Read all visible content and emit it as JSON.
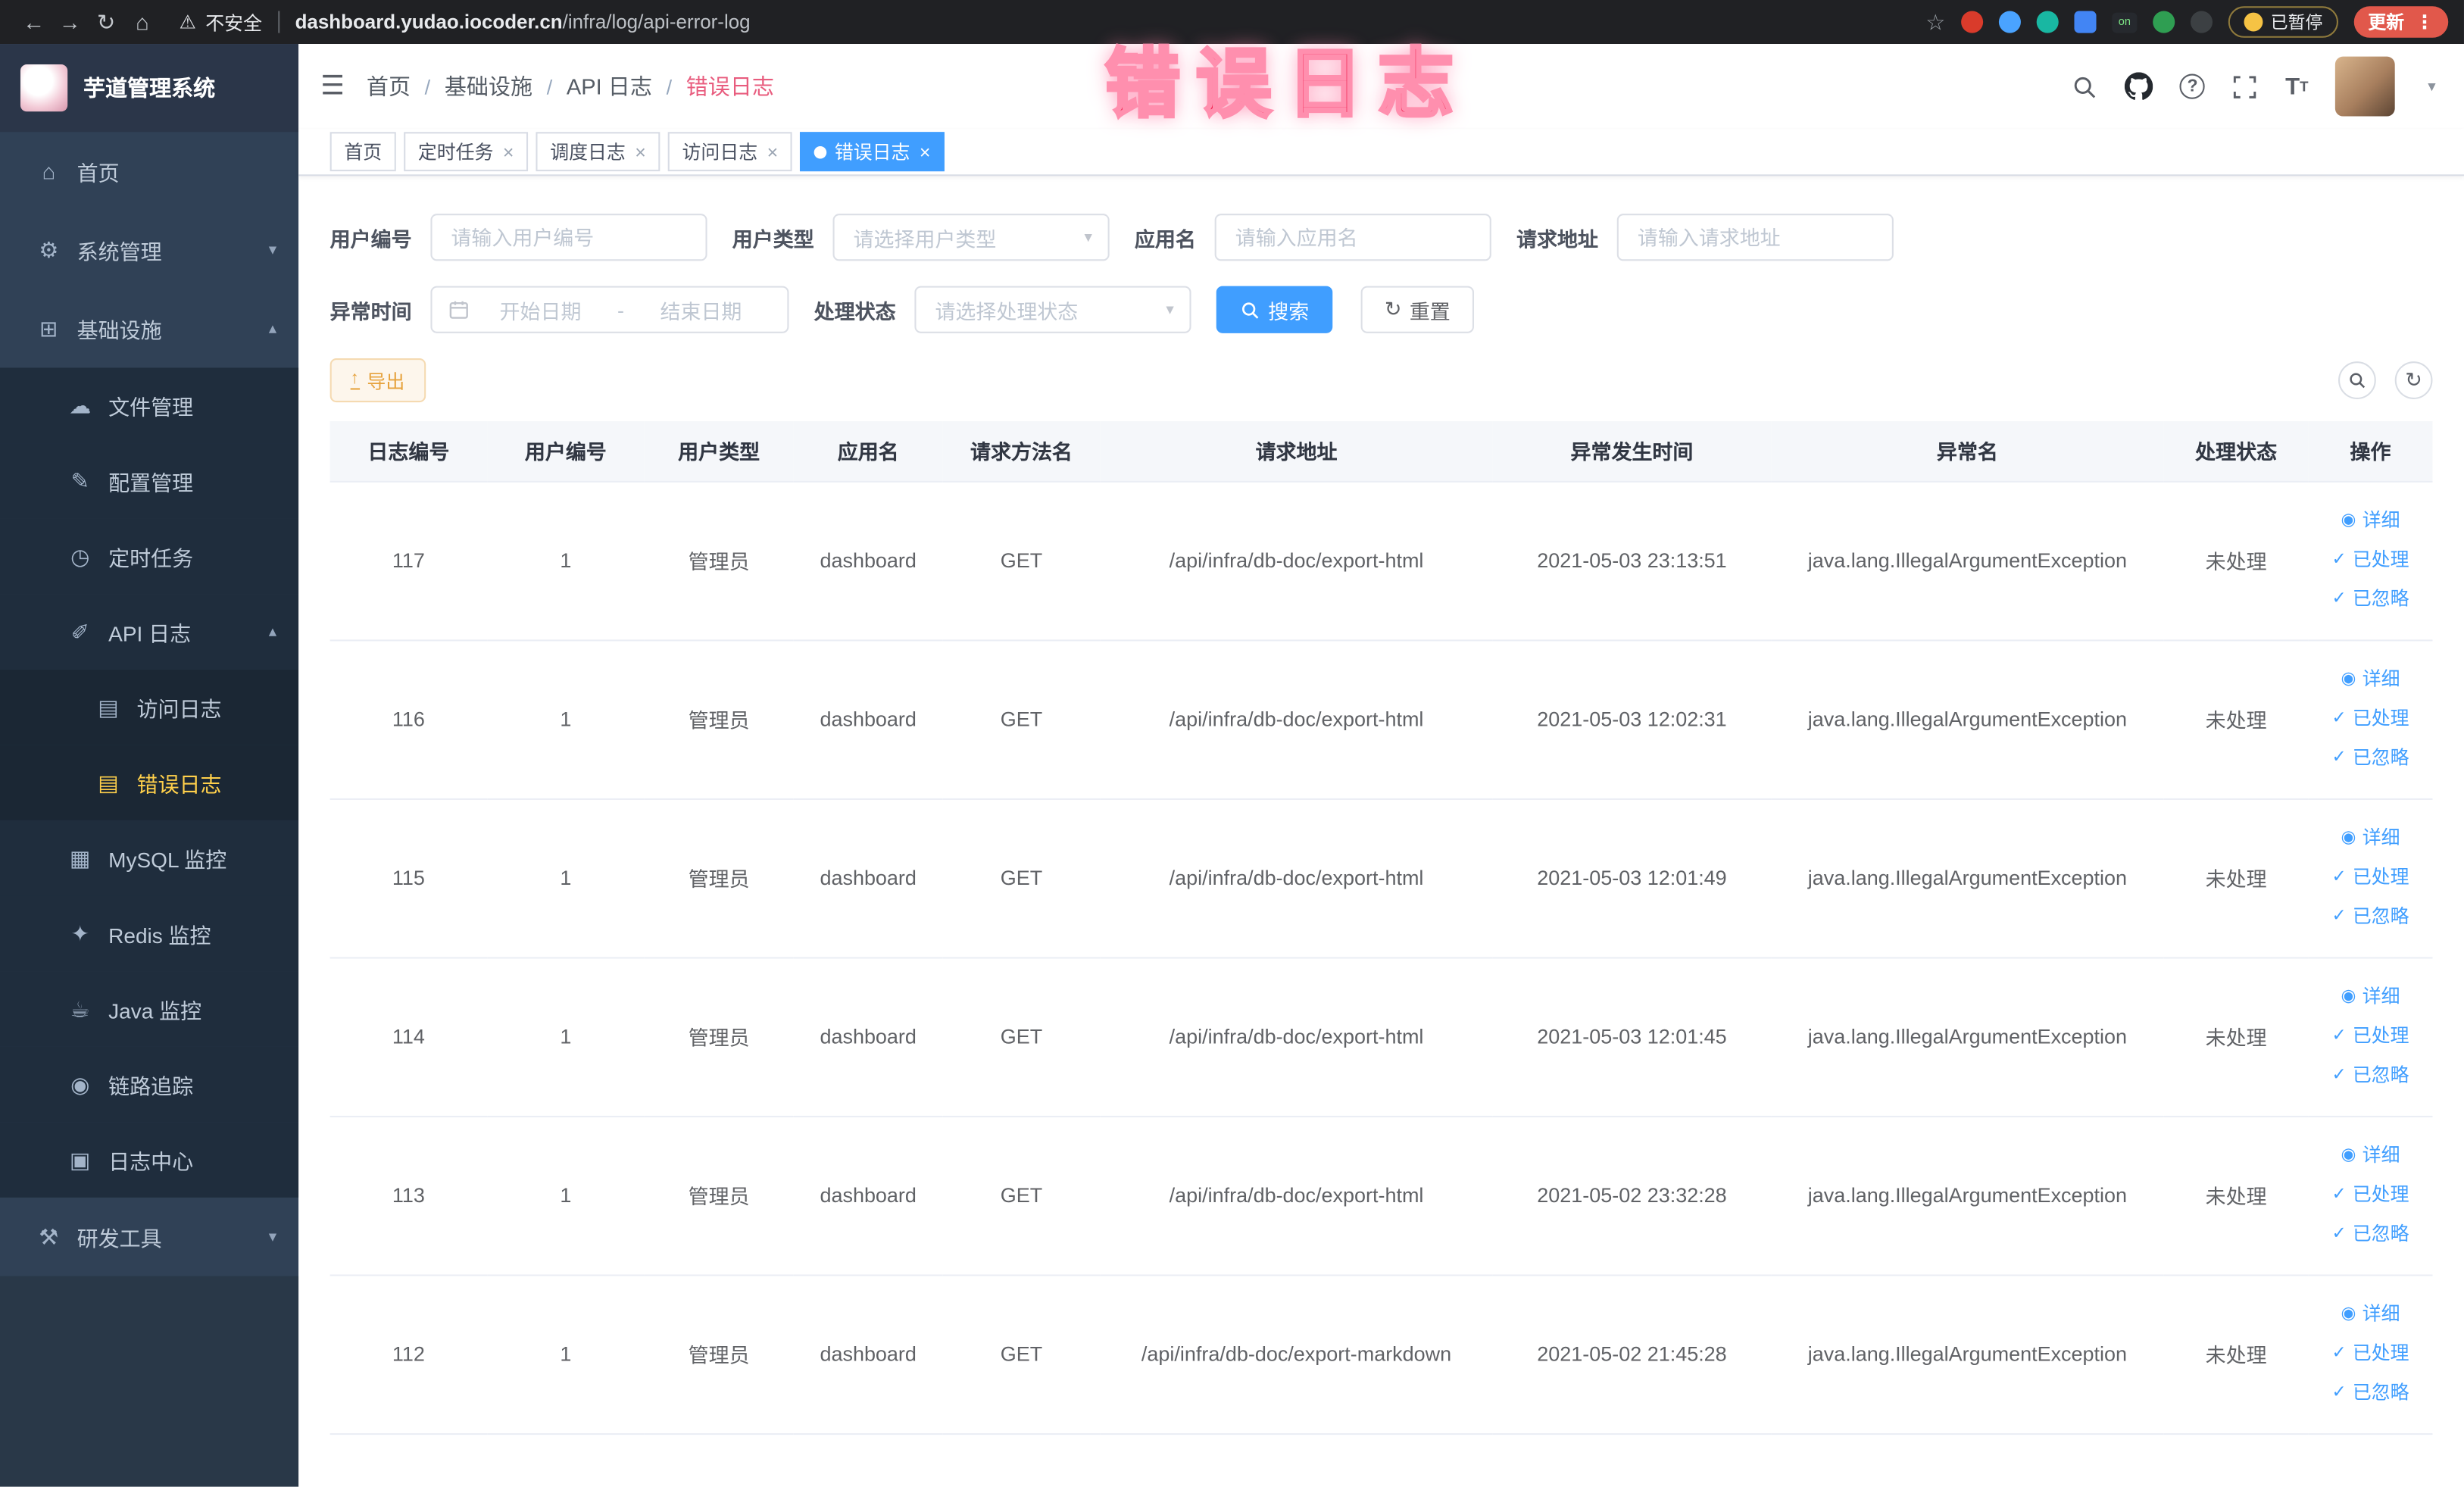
{
  "colors": {
    "primary": "#409eff",
    "sidebar_bg": "#304156",
    "active_menu": "#ffd04b",
    "warning": "#e6a23c"
  },
  "browser": {
    "security_label": "不安全",
    "url_domain": "dashboard.yudao.iocoder.cn",
    "url_path": "/infra/log/api-error-log",
    "paused_label": "已暂停",
    "update_label": "更新"
  },
  "annotation": {
    "text": "错误日志"
  },
  "sidebar": {
    "logo_title": "芋道管理系统",
    "items": [
      {
        "label": "首页",
        "icon": "home-icon"
      },
      {
        "label": "系统管理",
        "icon": "gear-icon"
      },
      {
        "label": "基础设施",
        "icon": "infrastructure-icon"
      },
      {
        "label": "文件管理",
        "icon": "file-icon"
      },
      {
        "label": "配置管理",
        "icon": "config-icon"
      },
      {
        "label": "定时任务",
        "icon": "timer-icon"
      },
      {
        "label": "API 日志",
        "icon": "api-log-icon"
      },
      {
        "label": "访问日志",
        "icon": "access-log-icon"
      },
      {
        "label": "错误日志",
        "icon": "error-log-icon"
      },
      {
        "label": "MySQL 监控",
        "icon": "mysql-icon"
      },
      {
        "label": "Redis 监控",
        "icon": "redis-icon"
      },
      {
        "label": "Java 监控",
        "icon": "java-icon"
      },
      {
        "label": "链路追踪",
        "icon": "trace-icon"
      },
      {
        "label": "日志中心",
        "icon": "log-center-icon"
      },
      {
        "label": "研发工具",
        "icon": "tools-icon"
      }
    ]
  },
  "header": {
    "breadcrumb": [
      "首页",
      "基础设施",
      "API 日志",
      "错误日志"
    ]
  },
  "tabs": [
    {
      "label": "首页"
    },
    {
      "label": "定时任务"
    },
    {
      "label": "调度日志"
    },
    {
      "label": "访问日志"
    },
    {
      "label": "错误日志"
    }
  ],
  "filters": {
    "user_id": {
      "label": "用户编号",
      "placeholder": "请输入用户编号"
    },
    "user_type": {
      "label": "用户类型",
      "placeholder": "请选择用户类型"
    },
    "app_name": {
      "label": "应用名",
      "placeholder": "请输入应用名"
    },
    "request_url": {
      "label": "请求地址",
      "placeholder": "请输入请求地址"
    },
    "exception_time": {
      "label": "异常时间",
      "start_placeholder": "开始日期",
      "separator": "-",
      "end_placeholder": "结束日期"
    },
    "process_status": {
      "label": "处理状态",
      "placeholder": "请选择处理状态"
    },
    "search_button": "搜索",
    "reset_button": "重置"
  },
  "toolbar": {
    "export_label": "导出"
  },
  "table": {
    "columns": [
      "日志编号",
      "用户编号",
      "用户类型",
      "应用名",
      "请求方法名",
      "请求地址",
      "异常发生时间",
      "异常名",
      "处理状态",
      "操作"
    ],
    "actions": {
      "detail": "详细",
      "processed": "已处理",
      "ignored": "已忽略"
    },
    "rows": [
      {
        "id": "117",
        "user_id": "1",
        "user_type": "管理员",
        "app": "dashboard",
        "method": "GET",
        "url": "/api/infra/db-doc/export-html",
        "time": "2021-05-03 23:13:51",
        "exception": "java.lang.IllegalArgumentException",
        "status": "未处理"
      },
      {
        "id": "116",
        "user_id": "1",
        "user_type": "管理员",
        "app": "dashboard",
        "method": "GET",
        "url": "/api/infra/db-doc/export-html",
        "time": "2021-05-03 12:02:31",
        "exception": "java.lang.IllegalArgumentException",
        "status": "未处理"
      },
      {
        "id": "115",
        "user_id": "1",
        "user_type": "管理员",
        "app": "dashboard",
        "method": "GET",
        "url": "/api/infra/db-doc/export-html",
        "time": "2021-05-03 12:01:49",
        "exception": "java.lang.IllegalArgumentException",
        "status": "未处理"
      },
      {
        "id": "114",
        "user_id": "1",
        "user_type": "管理员",
        "app": "dashboard",
        "method": "GET",
        "url": "/api/infra/db-doc/export-html",
        "time": "2021-05-03 12:01:45",
        "exception": "java.lang.IllegalArgumentException",
        "status": "未处理"
      },
      {
        "id": "113",
        "user_id": "1",
        "user_type": "管理员",
        "app": "dashboard",
        "method": "GET",
        "url": "/api/infra/db-doc/export-html",
        "time": "2021-05-02 23:32:28",
        "exception": "java.lang.IllegalArgumentException",
        "status": "未处理"
      },
      {
        "id": "112",
        "user_id": "1",
        "user_type": "管理员",
        "app": "dashboard",
        "method": "GET",
        "url": "/api/infra/db-doc/export-markdown",
        "time": "2021-05-02 21:45:28",
        "exception": "java.lang.IllegalArgumentException",
        "status": "未处理"
      }
    ]
  }
}
